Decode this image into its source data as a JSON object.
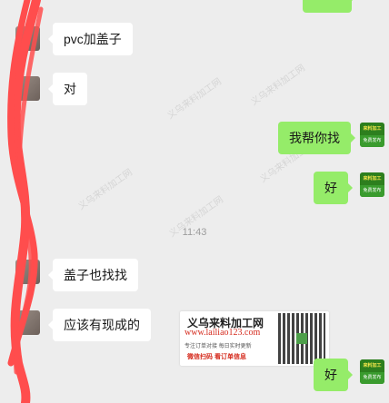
{
  "messages": [
    {
      "side": "left",
      "text": "pvc加盖子"
    },
    {
      "side": "left",
      "text": "对"
    },
    {
      "side": "right",
      "text": "我帮你找"
    },
    {
      "side": "right",
      "text": "好"
    },
    {
      "side": "left",
      "text": "盖子也找找"
    },
    {
      "side": "left",
      "text": "应该有现成的"
    },
    {
      "side": "right",
      "text": "好"
    }
  ],
  "timestamp": "11:43",
  "right_avatar": {
    "top_text": "来料加工",
    "bottom_text": "免费发布"
  },
  "ad": {
    "title": "义乌来料加工网",
    "url": "www.lailiao123.com",
    "desc": "专注订单对接 每日实时更新",
    "foot": "微信扫码  看订单信息"
  },
  "watermark": "义乌来料加工网",
  "colors": {
    "left_bubble": "#ffffff",
    "right_bubble": "#95ec69",
    "background": "#ededed",
    "scribble": "#ff4d4d"
  }
}
